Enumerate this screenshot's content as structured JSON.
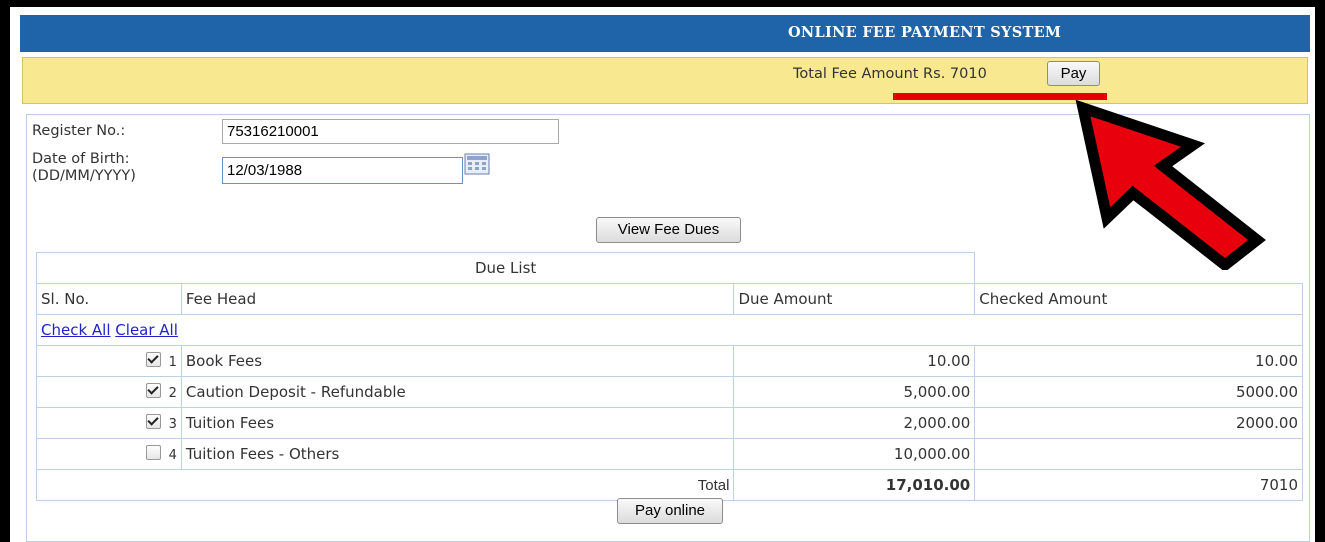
{
  "header": {
    "title": "ONLINE FEE PAYMENT SYSTEM"
  },
  "fee_bar": {
    "label": "Total Fee Amount Rs. 7010",
    "pay_button": "Pay"
  },
  "form": {
    "register_label": "Register No.:",
    "register_value": "75316210001",
    "dob_label_line1": "Date of Birth:",
    "dob_label_line2": "(DD/MM/YYYY)",
    "dob_value": "12/03/1988",
    "view_button": "View Fee Dues"
  },
  "due_list": {
    "caption": "Due List",
    "columns": [
      "Sl. No.",
      "Fee Head",
      "Due Amount",
      "Checked Amount"
    ],
    "check_all": "Check All",
    "clear_all": "Clear All",
    "rows": [
      {
        "sl": "1",
        "checked": true,
        "head": "Book Fees",
        "due": "10.00",
        "checked_amount": "10.00"
      },
      {
        "sl": "2",
        "checked": true,
        "head": "Caution Deposit - Refundable",
        "due": "5,000.00",
        "checked_amount": "5000.00"
      },
      {
        "sl": "3",
        "checked": true,
        "head": "Tuition Fees",
        "due": "2,000.00",
        "checked_amount": "2000.00"
      },
      {
        "sl": "4",
        "checked": false,
        "head": "Tuition Fees - Others",
        "due": "10,000.00",
        "checked_amount": ""
      }
    ],
    "total_label": "Total",
    "total_due": "17,010.00",
    "total_checked": "7010"
  },
  "pay_online_button": "Pay online",
  "colors": {
    "header": "#1f63a8",
    "fee_bar": "#f8e88f",
    "highlight": "#e60000"
  },
  "icons": {
    "calendar": "calendar-icon",
    "annotation": "arrow-pointer-icon"
  }
}
